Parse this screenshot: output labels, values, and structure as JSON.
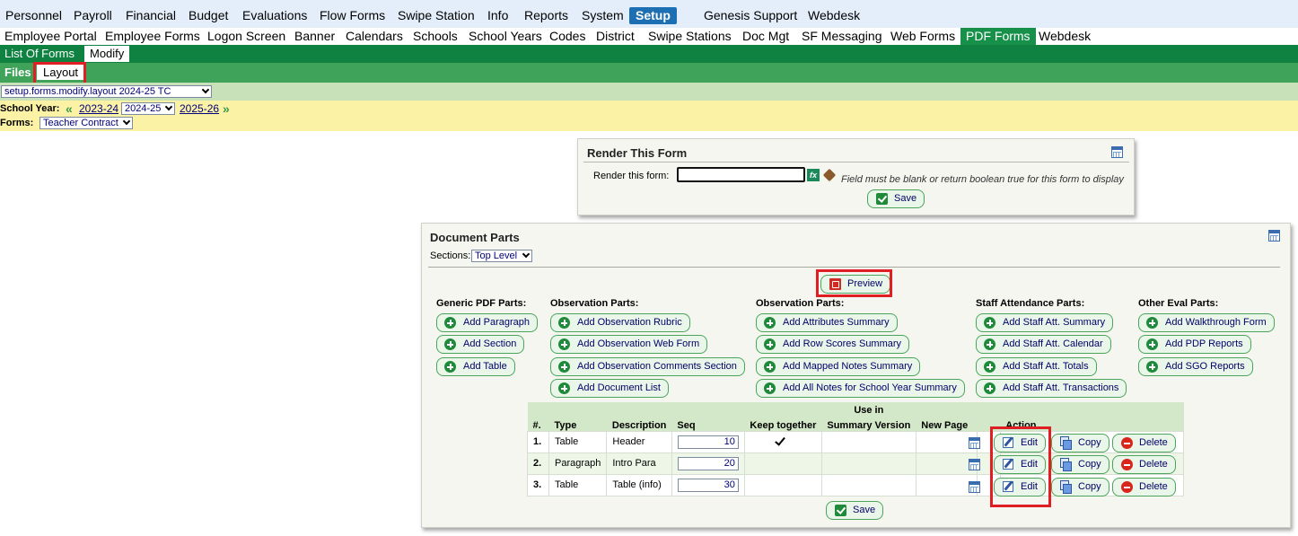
{
  "menu_primary": [
    "Personnel",
    "Payroll",
    "Financial",
    "Budget",
    "Evaluations",
    "Flow Forms",
    "Swipe Station",
    "Info",
    "Reports",
    "System",
    "Setup",
    "Genesis Support",
    "Webdesk"
  ],
  "menu_secondary": [
    "Employee Portal",
    "Employee Forms",
    "Logon Screen",
    "Banner",
    "Calendars",
    "Schools",
    "School Years",
    "Codes",
    "District",
    "Swipe Stations",
    "Doc Mgt",
    "SF Messaging",
    "Web Forms",
    "PDF Forms",
    "Webdesk"
  ],
  "menu_tertiary": [
    "List Of Forms",
    "Modify"
  ],
  "menu_quaternary": [
    "Files",
    "Layout"
  ],
  "active": {
    "primary": "Setup",
    "secondary": "PDF Forms",
    "tertiary": "Modify",
    "quaternary": "Layout"
  },
  "layout_select": "setup.forms.modify.layout 2024-25 TC",
  "school_year": {
    "label": "School Year:",
    "prev": "2023-24",
    "current": "2024-25",
    "next": "2025-26"
  },
  "forms": {
    "label": "Forms:",
    "value": "Teacher Contract"
  },
  "render_panel": {
    "title": "Render This Form",
    "field_label": "Render this form:",
    "field_value": "",
    "note": "Field must be blank or return boolean true for this form to display",
    "save": "Save"
  },
  "doc_panel": {
    "title": "Document Parts",
    "sections_label": "Sections:",
    "sections_value": "Top Level",
    "preview": "Preview",
    "groups": [
      {
        "title": "Generic PDF Parts:",
        "buttons": [
          "Add Paragraph",
          "Add Section",
          "Add Table"
        ]
      },
      {
        "title": "Observation Parts:",
        "buttons": [
          "Add Observation Rubric",
          "Add Observation Web Form",
          "Add Observation Comments Section",
          "Add Document List"
        ]
      },
      {
        "title": "Observation Parts:",
        "buttons": [
          "Add Attributes Summary",
          "Add Row Scores Summary",
          "Add Mapped Notes Summary",
          "Add All Notes for School Year Summary"
        ]
      },
      {
        "title": "Staff Attendance Parts:",
        "buttons": [
          "Add Staff Att. Summary",
          "Add Staff Att. Calendar",
          "Add Staff Att. Totals",
          "Add Staff Att. Transactions"
        ]
      },
      {
        "title": "Other Eval Parts:",
        "buttons": [
          "Add Walkthrough Form",
          "Add PDP Reports",
          "Add SGO Reports"
        ]
      }
    ],
    "table": {
      "use_in": "Use in",
      "headers": [
        "#.",
        "Type",
        "Description",
        "Seq",
        "Keep together",
        "Summary Version",
        "New Page",
        "Action"
      ],
      "rows": [
        {
          "num": "1.",
          "type": "Table",
          "description": "Header",
          "seq": "10",
          "keep_together": true
        },
        {
          "num": "2.",
          "type": "Paragraph",
          "description": "Intro Para",
          "seq": "20",
          "keep_together": false
        },
        {
          "num": "3.",
          "type": "Table",
          "description": "Table (info)",
          "seq": "30",
          "keep_together": false
        }
      ],
      "actions": [
        "Edit",
        "Copy",
        "Delete"
      ]
    },
    "save": "Save"
  }
}
